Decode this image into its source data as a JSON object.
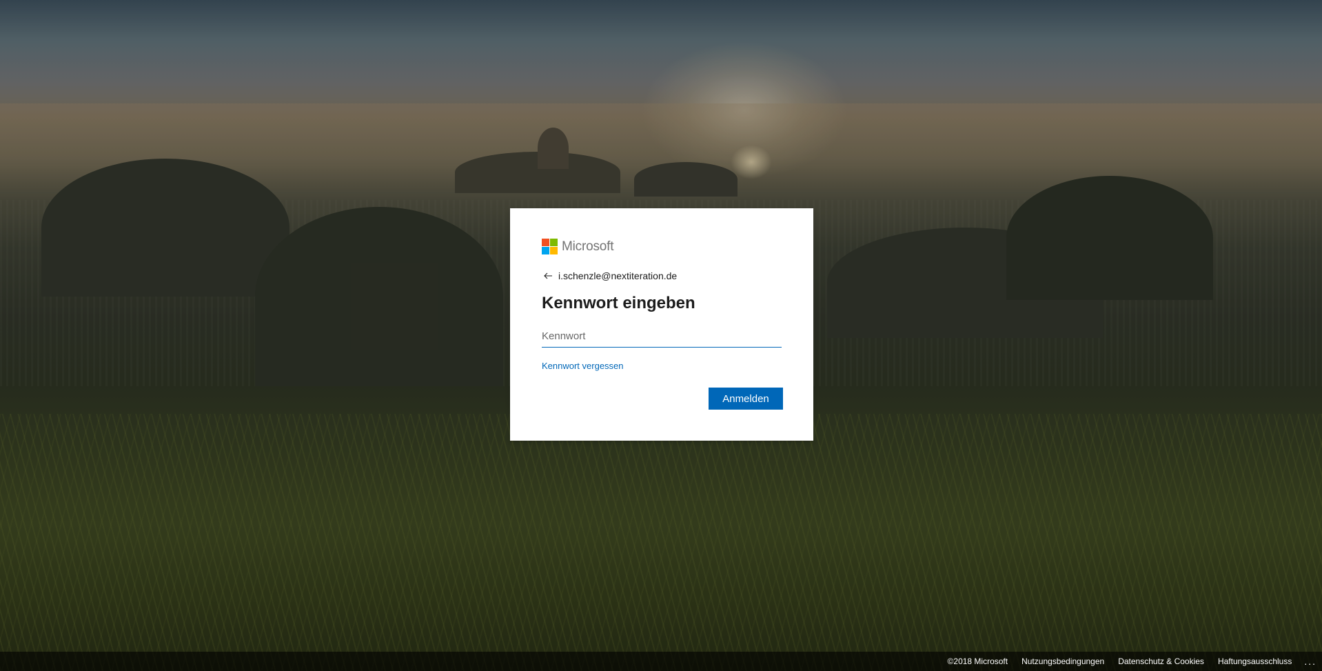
{
  "brand": {
    "name": "Microsoft",
    "logo_colors": [
      "#f25022",
      "#7fba00",
      "#00a4ef",
      "#ffb900"
    ]
  },
  "identity": {
    "email": "i.schenzle@nextiteration.de",
    "back_icon": "arrow-left-icon"
  },
  "form": {
    "title": "Kennwort eingeben",
    "password_placeholder": "Kennwort",
    "password_value": "",
    "forgot_link": "Kennwort vergessen",
    "submit_label": "Anmelden"
  },
  "colors": {
    "accent": "#0067b8",
    "card_background": "#ffffff"
  },
  "footer": {
    "copyright": "©2018 Microsoft",
    "terms": "Nutzungsbedingungen",
    "privacy": "Datenschutz & Cookies",
    "disclaimer": "Haftungsausschluss",
    "more": "..."
  }
}
